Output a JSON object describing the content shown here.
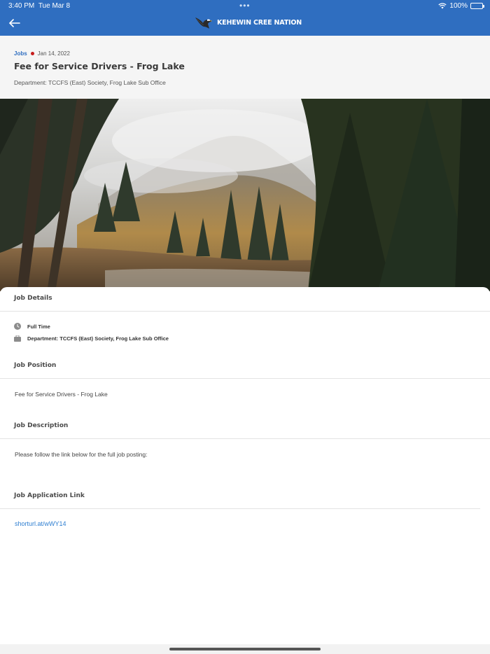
{
  "status_bar": {
    "time": "3:40 PM",
    "date": "Tue Mar 8",
    "battery": "100%",
    "battery_level": 1.0
  },
  "nav": {
    "title": "KEHEWIN CREE NATION",
    "back_icon": "arrow-left-icon",
    "logo_icon": "eagle-logo-icon"
  },
  "post": {
    "category": "Jobs",
    "date": "Jan 14, 2022",
    "title": "Fee for Service Drivers - Frog Lake",
    "department": "Department: TCCFS (East) Society, Frog Lake Sub Office"
  },
  "hero": {
    "description": "forest-mountain-photo"
  },
  "sections": {
    "job_details": {
      "heading": "Job Details",
      "items": [
        {
          "icon": "clock-icon",
          "text": "Full Time"
        },
        {
          "icon": "briefcase-icon",
          "text": "Department: TCCFS (East) Society, Frog Lake Sub Office"
        }
      ]
    },
    "job_position": {
      "heading": "Job Position",
      "text": "Fee for Service Drivers - Frog Lake"
    },
    "job_description": {
      "heading": "Job Description",
      "text": "Please follow the link below for the full job posting:"
    },
    "job_application": {
      "heading": "Job Application Link",
      "link": "shorturl.at/wWY14"
    }
  },
  "colors": {
    "accent": "#2f6ec0",
    "link": "#2f7fd1",
    "category_dot": "#c61d1d",
    "header_bg": "#f5f5f5"
  }
}
